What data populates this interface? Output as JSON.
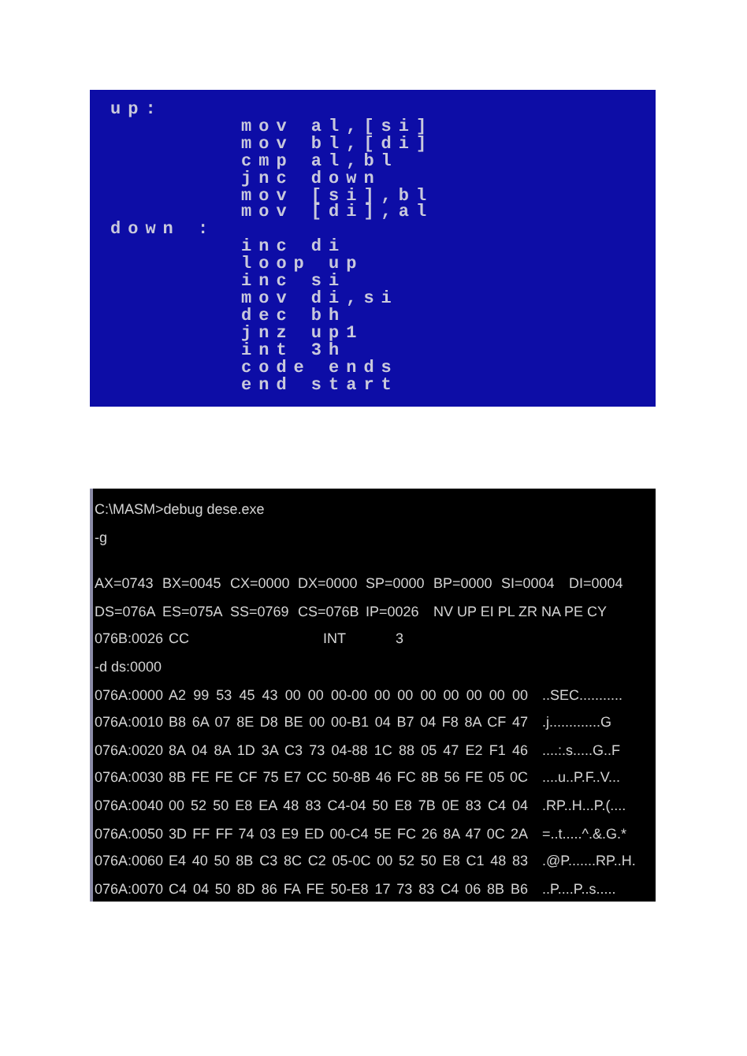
{
  "editor": {
    "lines": [
      {
        "kind": "label",
        "text": "up:"
      },
      {
        "kind": "code",
        "text": "mov al,[si]"
      },
      {
        "kind": "code",
        "text": "mov bl,[di]"
      },
      {
        "kind": "code",
        "text": "cmp al,bl"
      },
      {
        "kind": "code",
        "text": "jnc down"
      },
      {
        "kind": "code",
        "text": "mov [si],bl"
      },
      {
        "kind": "code",
        "text": "mov [di],al"
      },
      {
        "kind": "label",
        "text": "down :"
      },
      {
        "kind": "code",
        "text": "inc di"
      },
      {
        "kind": "code",
        "text": "loop up"
      },
      {
        "kind": "code",
        "text": "inc si"
      },
      {
        "kind": "code",
        "text": "mov di,si"
      },
      {
        "kind": "code",
        "text": "dec bh"
      },
      {
        "kind": "code",
        "text": "jnz up1"
      },
      {
        "kind": "code",
        "text": "int 3h"
      },
      {
        "kind": "code",
        "text": "code ends"
      },
      {
        "kind": "code",
        "text": "end start"
      }
    ]
  },
  "console": {
    "entries": [
      {
        "kind": "text",
        "text": "C:\\MASM>debug dese.exe"
      },
      {
        "kind": "text",
        "text": "-g"
      },
      {
        "kind": "gap"
      },
      {
        "kind": "registers",
        "items": [
          "AX=0743",
          "BX=0045",
          "CX=0000",
          "DX=0000",
          "SP=0000",
          "BP=0000",
          "SI=0004",
          "DI=0004"
        ]
      },
      {
        "kind": "registers",
        "items": [
          "DS=076A",
          "ES=075A",
          "SS=0769",
          "CS=076B",
          "IP=0026",
          "NV UP EI PL ZR NA PE CY"
        ]
      },
      {
        "kind": "instruction",
        "address": "076B:0026",
        "bytes": "CC",
        "mnemonic": "INT",
        "operand": "3"
      },
      {
        "kind": "text",
        "text": "-d ds:0000"
      },
      {
        "kind": "dump",
        "address": "076A:0000",
        "bytes": "A2 99 53 45 43 00 00 00-00 00 00 00 00 00 00 00",
        "ascii": "..SEC..........."
      },
      {
        "kind": "dump",
        "address": "076A:0010",
        "bytes": "B8 6A 07 8E D8 BE 00 00-B1 04 B7 04 F8 8A CF 47",
        "ascii": ".j.............G"
      },
      {
        "kind": "dump",
        "address": "076A:0020",
        "bytes": "8A 04 8A 1D 3A C3 73 04-88 1C 88 05 47 E2 F1 46",
        "ascii": "....:.s.....G..F"
      },
      {
        "kind": "dump",
        "address": "076A:0030",
        "bytes": "8B FE FE CF 75 E7 CC 50-8B 46 FC 8B 56 FE 05 0C",
        "ascii": "....u..P.F..V..."
      },
      {
        "kind": "dump",
        "address": "076A:0040",
        "bytes": "00 52 50 E8 EA 48 83 C4-04 50 E8 7B 0E 83 C4 04",
        "ascii": ".RP..H...P.(...."
      },
      {
        "kind": "dump",
        "address": "076A:0050",
        "bytes": "3D FF FF 74 03 E9 ED 00-C4 5E FC 26 8A 47 0C 2A",
        "ascii": "=..t.....^.&.G.*"
      },
      {
        "kind": "dump",
        "address": "076A:0060",
        "bytes": "E4 40 50 8B C3 8C C2 05-0C 00 52 50 E8 C1 48 83",
        "ascii": ".@P.......RP..H."
      },
      {
        "kind": "dump",
        "address": "076A:0070",
        "bytes": "C4 04 50 8D 86 FA FE 50-E8 17 73 83 C4 06 8B B6",
        "ascii": "..P....P..s....."
      }
    ]
  }
}
